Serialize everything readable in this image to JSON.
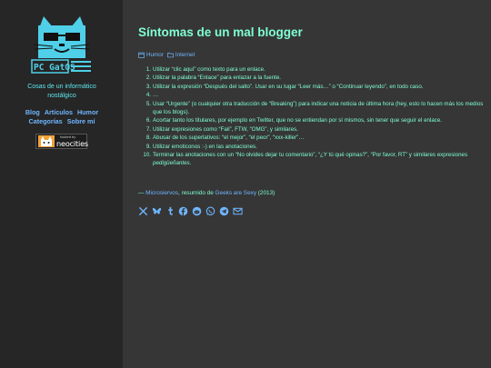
{
  "colors": {
    "accent": "#7fffd4",
    "link": "#6fb6ff",
    "cat": "#4fd0e8",
    "sidebar_bg": "#262626",
    "main_bg": "#363636"
  },
  "sidebar": {
    "logo_text": "PC GatOS",
    "description": "Cosas de un informático nostálgico",
    "nav": [
      "Blog",
      "Artículos",
      "Humor",
      "Categorías",
      "Sobre mí"
    ],
    "badge_small": "hosted by",
    "badge_big": "neocities"
  },
  "post": {
    "title": "Síntomas de un mal blogger",
    "categories": [
      "Humor",
      "Internet"
    ],
    "items": [
      "Utilizar “clic aquí” como texto para un enlace.",
      "Utilizar la palabra “Enlace” para enlazar a la fuente.",
      "Utilizar la expresión “Después del salto”. Usar en su lugar “Leer más…” o “Continuar leyendo”, en todo caso.",
      "…",
      "Usar “Urgente” (o cualquier otra traducción de “Breaking”) para indicar una noticia de última hora (hey, esto lo hacen más los medios que los blogs).",
      "Acortar tanto los titulares, por ejemplo en Twitter, que no se entiendan por sí mismos, sin tener que seguir el enlace.",
      "Utilizar expresiones como “Fail”, FTW, “OMG”, y similares.",
      "Abusar de los superlativos: “el mejor”, “el peor”, “xxx-killer”…",
      "Utilizar emoticonos :-) en las anotaciones.",
      "Terminar las anotaciones con un “No olvides dejar tu comentario”, “¿Y tú qué opinas?”, “Por favor, RT” y similares expresiones "
    ],
    "last_item_em": "pedigüeñantes",
    "last_item_end": ".",
    "credit_dash": "— ",
    "credit_author": "Microsiervos",
    "credit_mid": ", resumido de ",
    "credit_source": "Geeks are Sexy",
    "credit_year": " (2013)",
    "share_icons": [
      "x-icon",
      "bluesky-icon",
      "tumblr-icon",
      "facebook-icon",
      "reddit-icon",
      "whatsapp-icon",
      "telegram-icon",
      "email-icon"
    ]
  }
}
